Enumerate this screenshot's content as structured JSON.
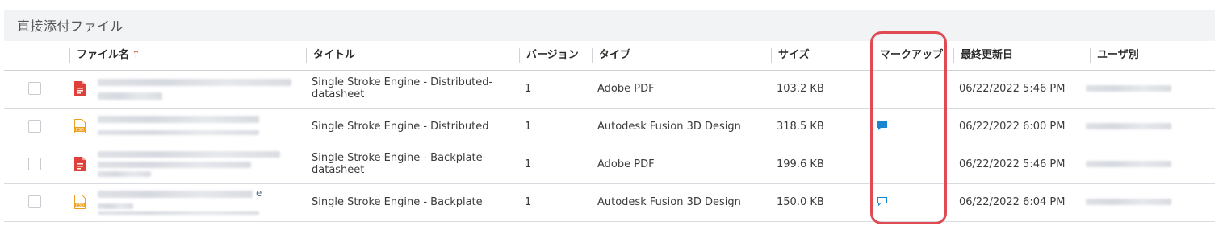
{
  "section": {
    "title": "直接添付ファイル"
  },
  "columns": {
    "file_name": "ファイル名",
    "sort_indicator": "↑",
    "title": "タイトル",
    "version": "バージョン",
    "type": "タイプ",
    "size": "サイズ",
    "markup": "マークアップ",
    "last_updated": "最終更新日",
    "user": "ユーザ別"
  },
  "rows": [
    {
      "icon": "pdf-file-icon",
      "title": "Single Stroke Engine - Distributed-datasheet",
      "version": "1",
      "type": "Adobe PDF",
      "size": "103.2 KB",
      "markup": "none",
      "updated": "06/22/2022 5:46 PM"
    },
    {
      "icon": "f3d-file-icon",
      "title": "Single Stroke Engine - Distributed",
      "version": "1",
      "type": "Autodesk Fusion 3D Design",
      "size": "318.5 KB",
      "markup": "filled",
      "updated": "06/22/2022 6:00 PM"
    },
    {
      "icon": "pdf-file-icon",
      "title": "Single Stroke Engine - Backplate-datasheet",
      "version": "1",
      "type": "Adobe PDF",
      "size": "199.6 KB",
      "markup": "none",
      "updated": "06/22/2022 5:46 PM"
    },
    {
      "icon": "f3d-file-icon",
      "title": "Single Stroke Engine - Backplate",
      "version": "1",
      "type": "Autodesk Fusion 3D Design",
      "size": "150.0 KB",
      "markup": "outline",
      "updated": "06/22/2022 6:04 PM",
      "file_name_suffix": "e"
    }
  ],
  "colors": {
    "pdf": "#e0403a",
    "f3d": "#f0a020",
    "markup": "#1a86d0",
    "highlight": "#e04a52"
  }
}
